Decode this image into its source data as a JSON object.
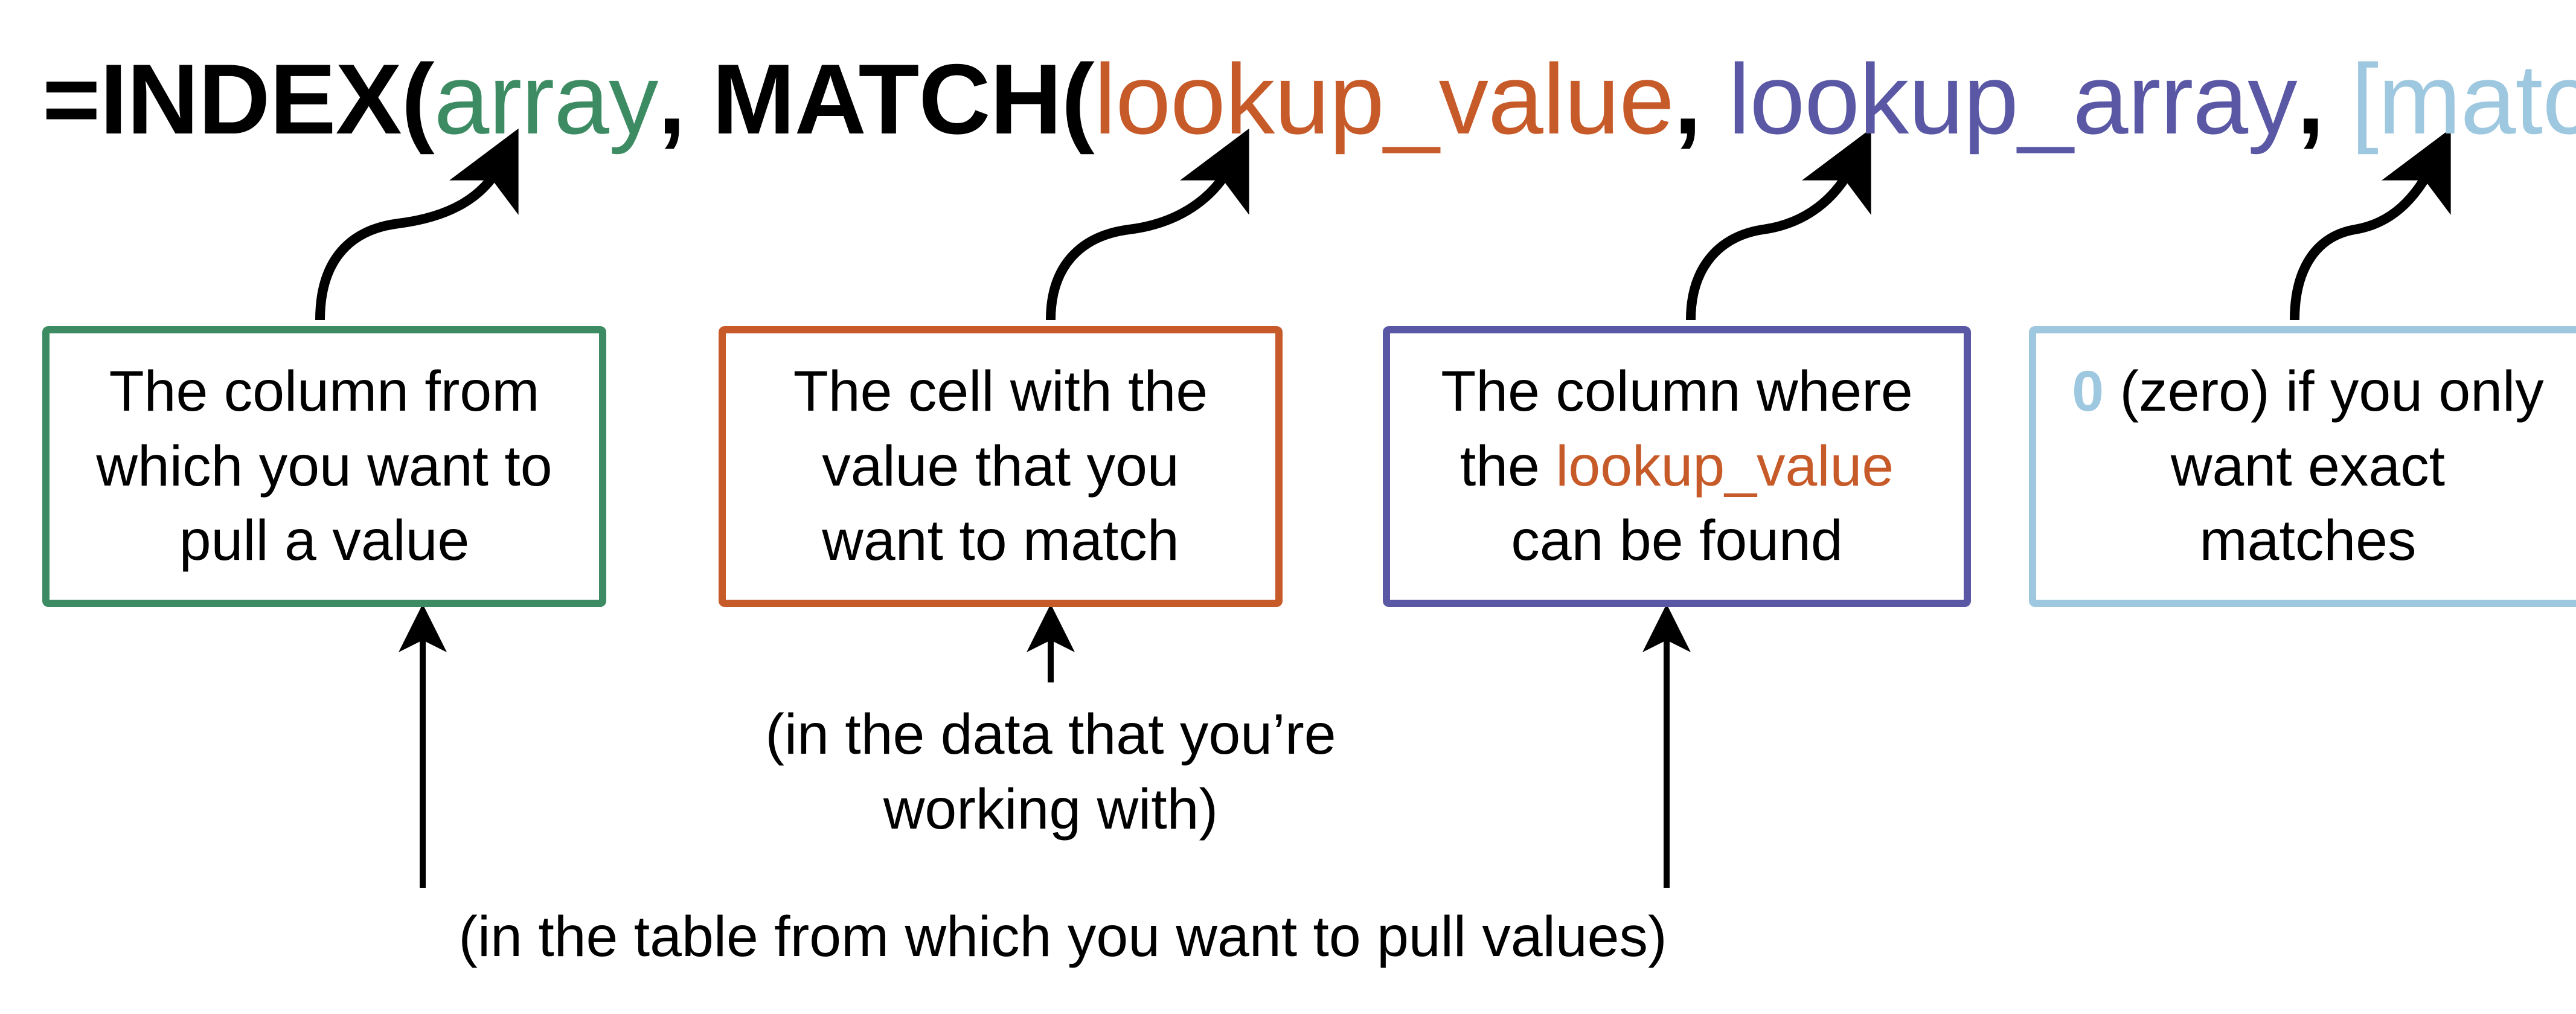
{
  "formula": {
    "eq": "=",
    "index": "INDEX(",
    "array": "array",
    "comma1": ", ",
    "match": "MATCH(",
    "lookup_value": "lookup_value",
    "comma2": ", ",
    "lookup_array": "lookup_array",
    "comma3": ", ",
    "match_type": "[match_type]",
    "close": "))"
  },
  "boxes": {
    "array": {
      "line1": "The column from",
      "line2": "which you want to",
      "line3": "pull a value"
    },
    "lookup_value": {
      "line1": "The cell with the",
      "line2": "value that you",
      "line3": "want to match"
    },
    "lookup_array": {
      "line1_a": "The column where",
      "line2_a": "the ",
      "line2_b": "lookup_value",
      "line3_a": "can be found"
    },
    "match_type": {
      "line1_a": "0",
      "line1_b": " (zero) if you only",
      "line2": "want exact",
      "line3": "matches"
    }
  },
  "captions": {
    "working_with": {
      "line1": "(in the data that you’re",
      "line2": "working with)"
    },
    "pull_values": "(in the table from which you want to pull values)"
  },
  "colors": {
    "array": "#3d8b63",
    "lookup_value": "#c75a29",
    "lookup_array": "#5a58a5",
    "match_type": "#9ec8df",
    "black": "#000000"
  }
}
